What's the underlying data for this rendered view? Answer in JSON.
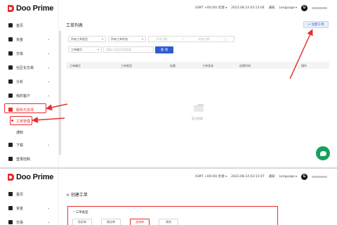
{
  "brand": {
    "logo_text": "Doo Prime"
  },
  "topbar": {
    "timezone": "(GMT +00:00) 伦敦",
    "datetime_1": "2023.08.14 03:13:04",
    "datetime_2": "2023.08.14 03:15:07",
    "notifications": "通知",
    "language": "Lenguage",
    "avatar_letter": "G"
  },
  "sidebar": {
    "items": [
      {
        "label": "首页",
        "icon": "home-icon"
      },
      {
        "label": "资金",
        "icon": "wallet-icon"
      },
      {
        "label": "交易",
        "icon": "trade-icon"
      },
      {
        "label": "社区化交易",
        "icon": "community-icon"
      },
      {
        "label": "分析",
        "icon": "analysis-icon"
      },
      {
        "label": "我的客户",
        "icon": "clients-icon"
      },
      {
        "label": "服务与支持",
        "icon": "support-icon"
      }
    ],
    "sub_items": [
      {
        "label": "工单管理"
      },
      {
        "label": "通知"
      }
    ],
    "more_items": [
      {
        "label": "下载",
        "icon": "download-icon"
      },
      {
        "label": "登录控制",
        "icon": "login-icon"
      }
    ]
  },
  "ticket_list": {
    "title": "工单列表",
    "create_button": "+ 创建工单",
    "filters": {
      "ticket_type": "所有工单类型",
      "ticket_status": "所有工单状态",
      "start_date": "开始日期",
      "end_date": "结束日期",
      "ticket_no": "工单编号",
      "search_placeholder": "请输入相关内容搜索",
      "query_button": "查 询"
    },
    "columns": [
      "工单编号",
      "工单类型",
      "标题",
      "工单状态",
      "创建时间",
      "操作"
    ],
    "empty_text": "暂无数据"
  },
  "create_ticket": {
    "title": "< 创建工单",
    "type_label": "工单类型",
    "required_mark": "*",
    "types": [
      "投诉单",
      "建议单",
      "咨询单",
      "其他"
    ],
    "selected_type_index": 2
  },
  "colors": {
    "brand_red": "#e62e2e",
    "primary_blue": "#2f5bd3",
    "chat_green": "#17a05d"
  }
}
